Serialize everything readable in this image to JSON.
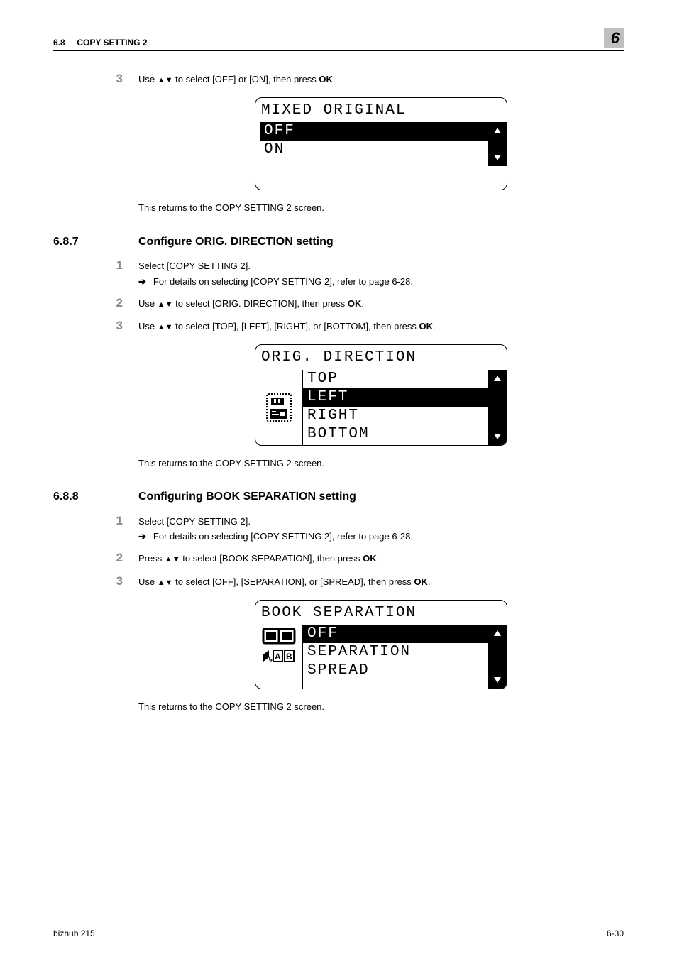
{
  "header": {
    "section_number": "6.8",
    "section_title_caps": "COPY SETTING 2",
    "chapter_number": "6"
  },
  "blockA": {
    "step_num": "3",
    "step_text_before": "Use ",
    "step_text_after": " to select [OFF] or [ON], then press ",
    "step_ok": "OK",
    "lcd_title": "MIXED ORIGINAL",
    "options": [
      "OFF",
      "ON"
    ],
    "selected_index": 0,
    "return_text": "This returns to the COPY SETTING 2 screen."
  },
  "section687": {
    "number": "6.8.7",
    "title": "Configure ORIG. DIRECTION setting",
    "steps": [
      {
        "num": "1",
        "text": "Select [COPY SETTING 2].",
        "sub": "For details on selecting [COPY SETTING 2], refer to page 6-28."
      },
      {
        "num": "2",
        "pre": "Use ",
        "mid": " to select [ORIG. DIRECTION], then press ",
        "ok": "OK"
      },
      {
        "num": "3",
        "pre": "Use ",
        "mid": " to select [TOP], [LEFT], [RIGHT], or [BOTTOM], then press ",
        "ok": "OK"
      }
    ],
    "lcd_title": "ORIG. DIRECTION",
    "options": [
      "TOP",
      "LEFT",
      "RIGHT",
      "BOTTOM"
    ],
    "selected_index": 1,
    "return_text": "This returns to the COPY SETTING 2 screen."
  },
  "section688": {
    "number": "6.8.8",
    "title": "Configuring BOOK SEPARATION setting",
    "steps": [
      {
        "num": "1",
        "text": "Select [COPY SETTING 2].",
        "sub": "For details on selecting [COPY SETTING 2], refer to page 6-28."
      },
      {
        "num": "2",
        "pre": "Press ",
        "mid": " to select [BOOK SEPARATION], then press ",
        "ok": "OK"
      },
      {
        "num": "3",
        "pre": "Use ",
        "mid": " to select [OFF], [SEPARATION], or [SPREAD], then press ",
        "ok": "OK"
      }
    ],
    "lcd_title": "BOOK SEPARATION",
    "options": [
      "OFF",
      "SEPARATION",
      "SPREAD"
    ],
    "selected_index": 0,
    "return_text": "This returns to the COPY SETTING 2 screen."
  },
  "footer": {
    "left": "bizhub 215",
    "right": "6-30"
  },
  "glyphs": {
    "up_down_arrows": "▲▼",
    "period": "."
  }
}
